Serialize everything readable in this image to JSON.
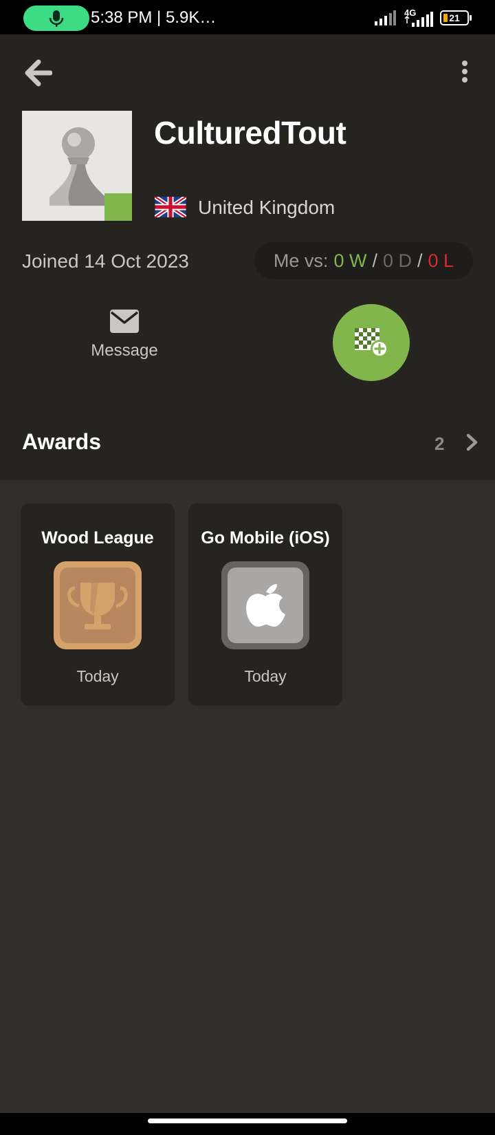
{
  "status_bar": {
    "time_text": "5:38 PM | 5.9K…",
    "network": "4G",
    "battery": "21",
    "icons": [
      "mic-icon",
      "signal-icon",
      "signal-4g-icon",
      "battery-icon"
    ]
  },
  "toolbar": {
    "back_icon": "back-arrow-icon",
    "more_icon": "more-vertical-icon"
  },
  "profile": {
    "username": "CulturedTout",
    "country": "United Kingdom",
    "joined": "Joined 14 Oct 2023",
    "online_status_color": "#81b64c"
  },
  "record": {
    "label": "Me vs:",
    "wins": "0 W",
    "draws": "0 D",
    "losses": "0 L",
    "separator": "/"
  },
  "actions": {
    "message_label": "Message",
    "challenge_icon": "challenge-board-plus-icon"
  },
  "awards": {
    "title": "Awards",
    "count": "2",
    "items": [
      {
        "title": "Wood League",
        "date": "Today",
        "icon": "trophy-icon"
      },
      {
        "title": "Go Mobile (iOS)",
        "date": "Today",
        "icon": "apple-icon"
      }
    ]
  },
  "colors": {
    "accent": "#81b64c",
    "loss": "#e02828",
    "background": "#312e2b",
    "header_bg": "#262421"
  }
}
